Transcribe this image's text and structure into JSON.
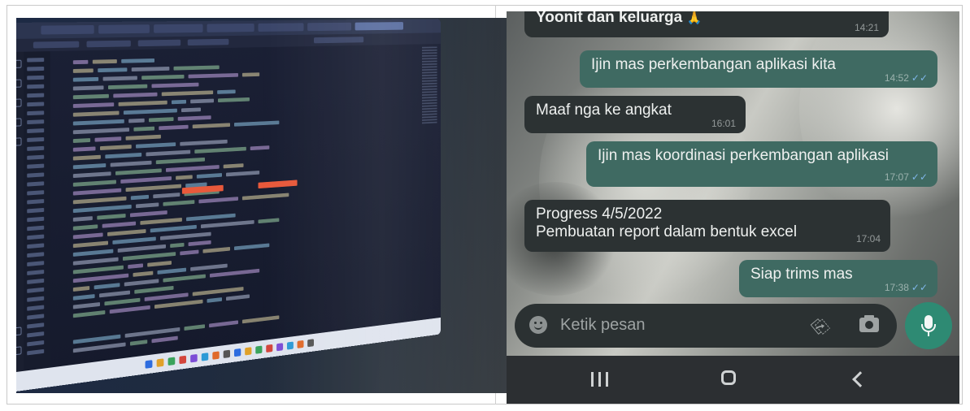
{
  "chat": {
    "messages": [
      {
        "direction": "in",
        "text": "Yoonit dan keluarga",
        "time": "14:21",
        "emoji": "🙏"
      },
      {
        "direction": "out",
        "text": "Ijin mas perkembangan aplikasi kita",
        "time": "14:52",
        "ticks": "✓✓"
      },
      {
        "direction": "in",
        "text": "Maaf nga ke angkat",
        "time": "16:01"
      },
      {
        "direction": "out",
        "text": "Ijin mas koordinasi perkembangan aplikasi",
        "time": "17:07",
        "ticks": "✓✓"
      },
      {
        "direction": "in",
        "lines": [
          "Progress 4/5/2022",
          "Pembuatan report dalam bentuk excel"
        ],
        "time": "17:04"
      },
      {
        "direction": "out",
        "text": "Siap trims mas",
        "time": "17:38",
        "ticks": "✓✓"
      }
    ],
    "input": {
      "placeholder": "Ketik pesan"
    },
    "icons": {
      "emoji": "emoji-icon",
      "attach": "paperclip-icon",
      "camera": "camera-icon",
      "mic": "microphone-icon"
    },
    "colors": {
      "incoming": "#2c3233",
      "outgoing": "#3f6a62",
      "accent": "#2e8a73",
      "read_ticks": "#7fb6e8"
    }
  },
  "navbar": {
    "buttons": [
      "recent-apps",
      "home",
      "back"
    ]
  },
  "editor": {
    "highlight_color": "#e8593b"
  }
}
